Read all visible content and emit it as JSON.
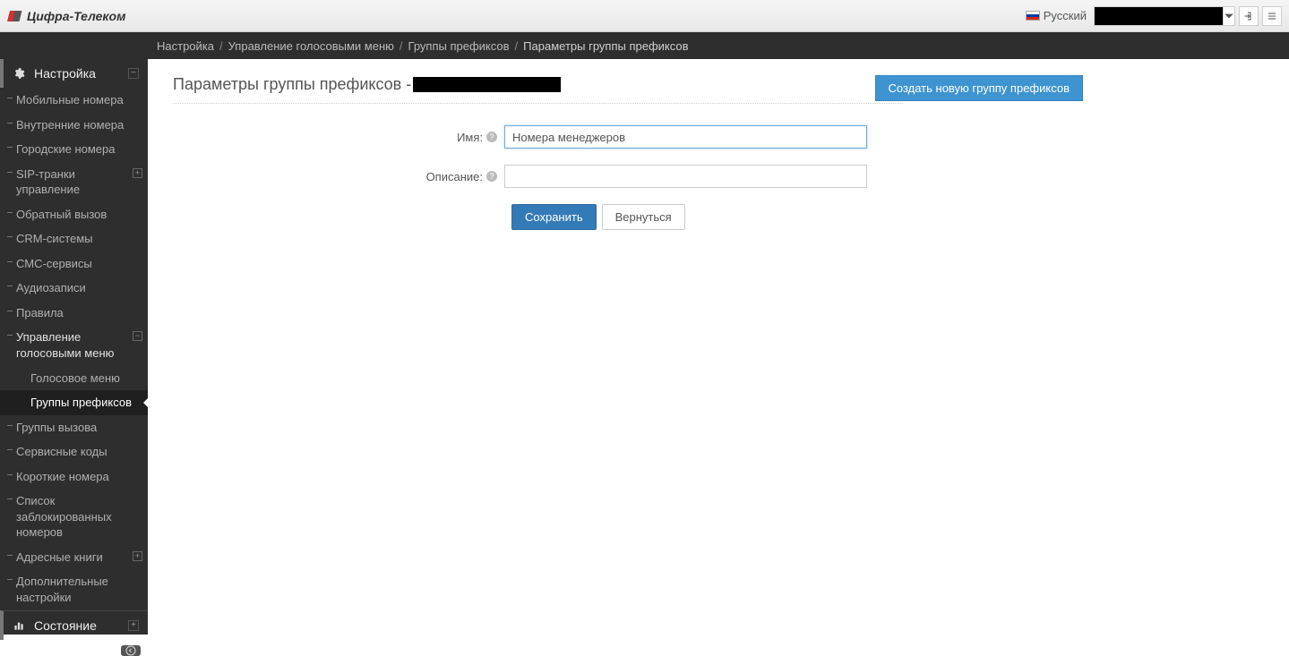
{
  "header": {
    "brand": "Цифра-Телеком",
    "language": "Русский"
  },
  "breadcrumb": {
    "items": [
      "Настройка",
      "Управление голосовыми меню",
      "Группы префиксов"
    ],
    "current": "Параметры группы префиксов"
  },
  "sidebar": {
    "settings_label": "Настройка",
    "status_label": "Состояние",
    "items": [
      "Мобильные номера",
      "Внутренние номера",
      "Городские номера",
      "SIP-транки управление",
      "Обратный вызов",
      "CRM-системы",
      "СМС-сервисы",
      "Аудиозаписи",
      "Правила",
      "Управление голосовыми меню",
      "Группы вызова",
      "Сервисные коды",
      "Короткие номера",
      "Список заблокированных номеров",
      "Адресные книги",
      "Дополнительные настройки"
    ],
    "sub_items": [
      "Голосовое меню",
      "Группы префиксов"
    ]
  },
  "page": {
    "title_prefix": "Параметры группы префиксов -",
    "create_button": "Создать новую группу префиксов",
    "name_label": "Имя:",
    "name_value": "Номера менеджеров",
    "desc_label": "Описание:",
    "desc_value": "",
    "save": "Сохранить",
    "back": "Вернуться"
  }
}
